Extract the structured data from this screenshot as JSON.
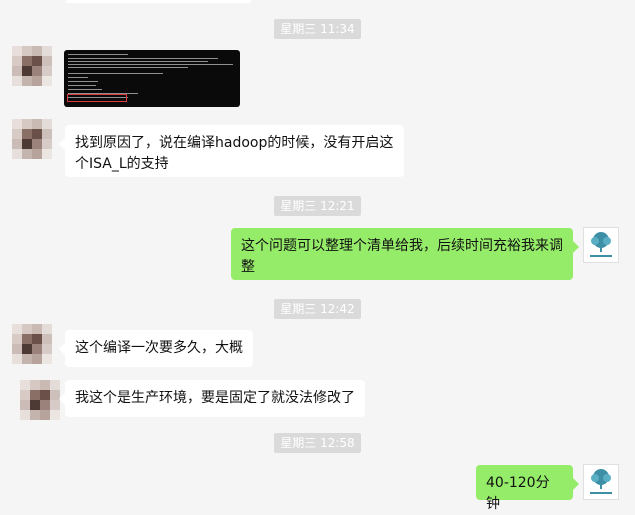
{
  "timestamps": [
    "星期三 11:34",
    "星期三 12:21",
    "星期三 12:42",
    "星期三 12:58"
  ],
  "messages": {
    "m1": "找到原因了，说在编译hadoop的时候，没有开启这个ISA_L的支持",
    "m2": "这个问题可以整理个清单给我，后续时间充裕我来调整",
    "m3": "这个编译一次要多久，大概",
    "m4": "我这个是生产环境，要是固定了就没法修改了",
    "m5": "40-120分钟"
  },
  "colors": {
    "incoming_bubble": "#ffffff",
    "outgoing_bubble": "#95ec69",
    "timestamp_bg": "#dadada",
    "background": "#f5f5f5"
  },
  "icons": {
    "contact_avatar": "pixelated-avatar",
    "self_avatar": "tree-logo-avatar",
    "attachment": "terminal-screenshot-image"
  }
}
